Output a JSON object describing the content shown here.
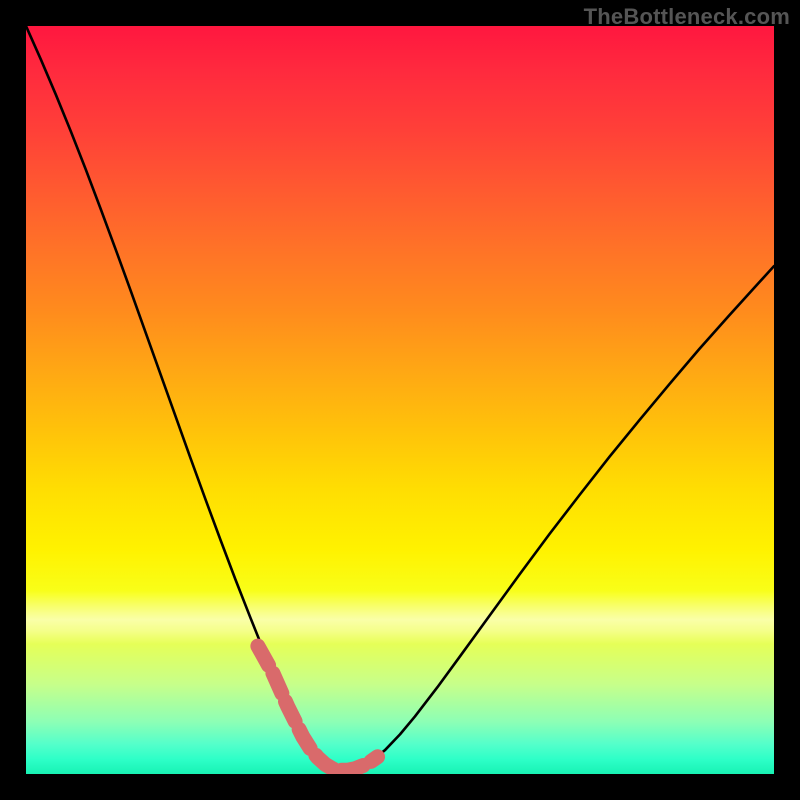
{
  "watermark": "TheBottleneck.com",
  "colors": {
    "frame": "#000000",
    "curve": "#000000",
    "marker": "#d96a6b",
    "gradient_top": "#ff173f",
    "gradient_bottom": "#18f2b4"
  },
  "chart_data": {
    "type": "line",
    "title": "",
    "xlabel": "",
    "ylabel": "",
    "xlim": [
      0,
      100
    ],
    "ylim": [
      0,
      100
    ],
    "x": [
      0,
      2,
      4,
      6,
      8,
      10,
      12,
      14,
      16,
      18,
      20,
      22,
      24,
      26,
      28,
      30,
      32,
      33,
      34,
      35,
      36,
      37,
      38,
      39,
      40,
      41,
      42,
      43,
      44,
      46,
      48,
      50,
      52,
      55,
      58,
      62,
      66,
      70,
      74,
      78,
      82,
      86,
      90,
      94,
      98,
      100
    ],
    "values": [
      100,
      95.5,
      90.8,
      85.9,
      80.8,
      75.5,
      70.1,
      64.6,
      59.0,
      53.4,
      47.8,
      42.2,
      36.7,
      31.3,
      26.0,
      20.9,
      15.9,
      13.5,
      11.2,
      9.0,
      6.9,
      5.0,
      3.4,
      2.2,
      1.3,
      0.7,
      0.5,
      0.5,
      0.7,
      1.6,
      3.2,
      5.3,
      7.7,
      11.6,
      15.7,
      21.2,
      26.7,
      32.1,
      37.3,
      42.4,
      47.3,
      52.1,
      56.8,
      61.3,
      65.7,
      67.9
    ],
    "highlight_region": {
      "x": [
        31,
        33,
        35,
        37,
        38,
        39,
        40,
        41,
        42,
        43,
        44,
        45,
        46,
        47
      ],
      "y": [
        17.1,
        13.5,
        9.0,
        5.0,
        3.4,
        2.2,
        1.3,
        0.7,
        0.5,
        0.5,
        0.7,
        1.1,
        1.6,
        2.3
      ]
    },
    "annotations": []
  }
}
